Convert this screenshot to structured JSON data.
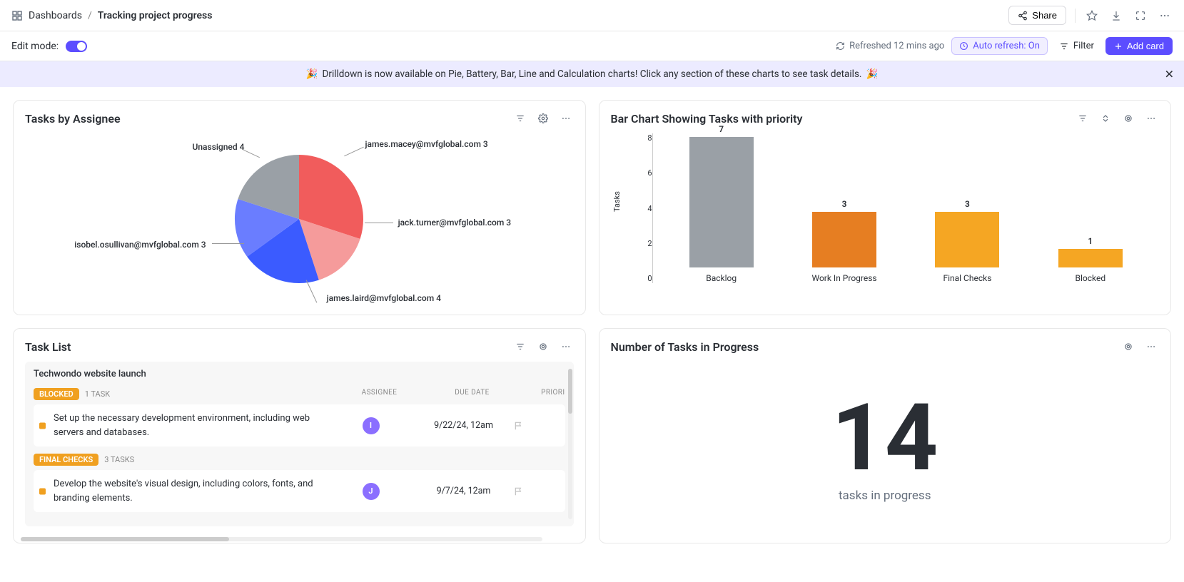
{
  "breadcrumb": {
    "root": "Dashboards",
    "current": "Tracking project progress"
  },
  "topbar": {
    "share": "Share"
  },
  "editbar": {
    "label": "Edit mode:",
    "refreshed": "Refreshed 12 mins ago",
    "autorefresh": "Auto refresh: On",
    "filter": "Filter",
    "addcard": "Add card"
  },
  "banner": {
    "text": "Drilldown is now available on Pie, Battery, Bar, Line and Calculation charts! Click any section of these charts to see task details."
  },
  "cards": {
    "pie": {
      "title": "Tasks by Assignee"
    },
    "bar": {
      "title": "Bar Chart Showing Tasks with priority"
    },
    "tasklist": {
      "title": "Task List"
    },
    "progress": {
      "title": "Number of Tasks in Progress",
      "value": "14",
      "label": "tasks in progress"
    }
  },
  "tasklist": {
    "project": "Techwondo website launch",
    "headers": {
      "assignee": "ASSIGNEE",
      "due": "DUE DATE",
      "priority": "PRIORI"
    },
    "groups": [
      {
        "badge": "BLOCKED",
        "count": "1 TASK",
        "tasks": [
          {
            "desc": "Set up the necessary development environment, including web servers and databases.",
            "avatar": "I",
            "due": "9/22/24, 12am"
          }
        ]
      },
      {
        "badge": "FINAL CHECKS",
        "count": "3 TASKS",
        "tasks": [
          {
            "desc": "Develop the website's visual design, including colors, fonts, and branding elements.",
            "avatar": "J",
            "due": "9/7/24, 12am"
          }
        ]
      }
    ]
  },
  "chart_data": [
    {
      "type": "pie",
      "title": "Tasks by Assignee",
      "series": [
        {
          "name": "james.macey@mvfglobal.com",
          "value": 3,
          "color": "#f15c5c"
        },
        {
          "name": "jack.turner@mvfglobal.com",
          "value": 3,
          "color": "#f59b9b"
        },
        {
          "name": "james.laird@mvfglobal.com",
          "value": 4,
          "color": "#3b5bff"
        },
        {
          "name": "isobel.osullivan@mvfglobal.com",
          "value": 3,
          "color": "#6a7dff"
        },
        {
          "name": "Unassigned",
          "value": 4,
          "color": "#9aa0a6"
        }
      ]
    },
    {
      "type": "bar",
      "title": "Bar Chart Showing Tasks with priority",
      "ylabel": "Tasks",
      "ylim": [
        0,
        8
      ],
      "yticks": [
        0,
        2,
        4,
        6,
        8
      ],
      "categories": [
        "Backlog",
        "Work In Progress",
        "Final Checks",
        "Blocked"
      ],
      "values": [
        7,
        3,
        3,
        1
      ],
      "colors": [
        "#9aa0a6",
        "#e67e22",
        "#f5a623",
        "#f5a623"
      ]
    }
  ],
  "pie_labels": {
    "p0": "james.macey@mvfglobal.com 3",
    "p1": "jack.turner@mvfglobal.com 3",
    "p2": "james.laird@mvfglobal.com 4",
    "p3": "isobel.osullivan@mvfglobal.com 3",
    "p4": "Unassigned 4"
  },
  "bar_display": {
    "ylabel": "Tasks",
    "ticks": {
      "t0": "8",
      "t1": "6",
      "t2": "4",
      "t3": "2",
      "t4": "0"
    },
    "v0": "7",
    "v1": "3",
    "v2": "3",
    "v3": "1",
    "c0": "Backlog",
    "c1": "Work In Progress",
    "c2": "Final Checks",
    "c3": "Blocked"
  }
}
